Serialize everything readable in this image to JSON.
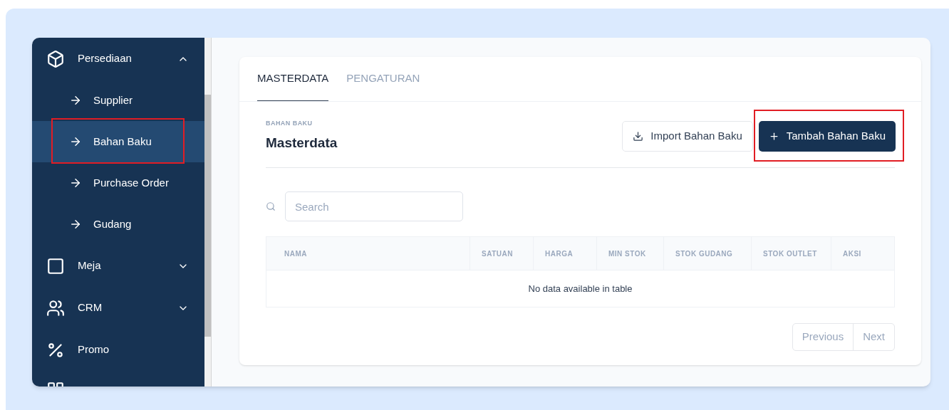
{
  "sidebar": {
    "items": [
      {
        "kind": "group",
        "label": "Persediaan",
        "expanded": true,
        "children": [
          {
            "label": "Supplier",
            "selected": false,
            "highlighted": false
          },
          {
            "label": "Bahan Baku",
            "selected": true,
            "highlighted": true
          },
          {
            "label": "Purchase Order",
            "selected": false,
            "highlighted": false
          },
          {
            "label": "Gudang",
            "selected": false,
            "highlighted": false
          }
        ]
      },
      {
        "kind": "group",
        "label": "Meja",
        "expanded": false
      },
      {
        "kind": "group",
        "label": "CRM",
        "expanded": false
      },
      {
        "kind": "link",
        "label": "Promo"
      }
    ]
  },
  "tabs": [
    {
      "label": "MASTERDATA",
      "selected": true
    },
    {
      "label": "PENGATURAN",
      "selected": false
    }
  ],
  "header": {
    "eyebrow": "BAHAN BAKU",
    "title": "Masterdata"
  },
  "buttons": [
    {
      "kind": "import",
      "label": "Import Bahan Baku",
      "highlighted": false
    },
    {
      "kind": "add",
      "label": "Tambah Bahan Baku",
      "highlighted": true
    }
  ],
  "search": {
    "placeholder": "Search"
  },
  "table": {
    "columns": [
      "NAMA",
      "SATUAN",
      "HARGA",
      "MIN STOK",
      "STOK GUDANG",
      "STOK OUTLET",
      "AKSI"
    ],
    "empty_message": "No data available in table"
  },
  "pagination": [
    "Previous",
    "Next"
  ]
}
